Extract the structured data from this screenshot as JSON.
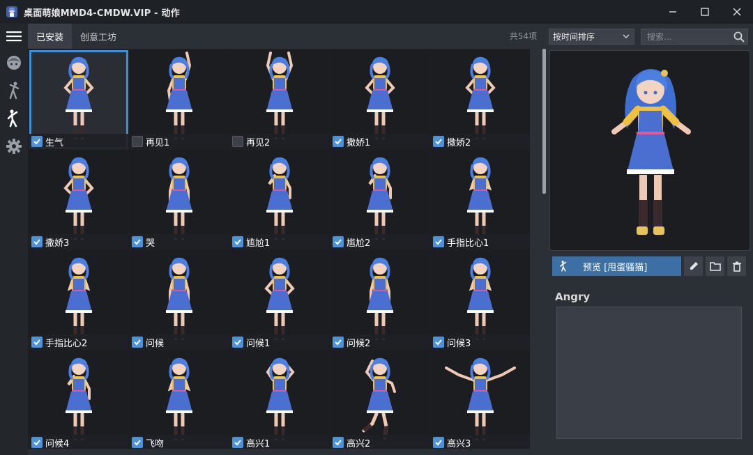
{
  "window": {
    "title": "桌面萌娘MMD4-CMDW.VIP - 动作",
    "controls": [
      "minimize-icon",
      "maximize-icon",
      "close-icon"
    ]
  },
  "rail": {
    "items": [
      {
        "icon": "menu-icon"
      },
      {
        "icon": "face-icon"
      },
      {
        "icon": "pose-icon"
      },
      {
        "icon": "action-icon",
        "active": true
      },
      {
        "icon": "gear-icon"
      }
    ]
  },
  "tabs": [
    {
      "label": "已安装",
      "active": true
    },
    {
      "label": "创意工坊",
      "active": false
    }
  ],
  "count_text": "共54项",
  "sort": {
    "value": "按时间排序"
  },
  "search": {
    "placeholder": "搜索..."
  },
  "grid": {
    "items": [
      {
        "label": "生气",
        "checked": true,
        "selected": true,
        "pose": "hips"
      },
      {
        "label": "再见1",
        "checked": false,
        "pose": "waveR"
      },
      {
        "label": "再见2",
        "checked": false,
        "pose": "bothUp"
      },
      {
        "label": "撒娇1",
        "checked": true,
        "pose": "hips"
      },
      {
        "label": "撒娇2",
        "checked": true,
        "pose": "hips"
      },
      {
        "label": "撒娇3",
        "checked": true,
        "pose": "hips"
      },
      {
        "label": "哭",
        "checked": true,
        "pose": "down"
      },
      {
        "label": "尴尬1",
        "checked": true,
        "pose": "face"
      },
      {
        "label": "尴尬2",
        "checked": true,
        "pose": "face"
      },
      {
        "label": "手指比心1",
        "checked": true,
        "pose": "chest"
      },
      {
        "label": "手指比心2",
        "checked": true,
        "pose": "chest"
      },
      {
        "label": "问候",
        "checked": true,
        "pose": "down"
      },
      {
        "label": "问候1",
        "checked": true,
        "pose": "hips"
      },
      {
        "label": "问候2",
        "checked": true,
        "pose": "down"
      },
      {
        "label": "问候3",
        "checked": true,
        "pose": "chest"
      },
      {
        "label": "问候4",
        "checked": true,
        "pose": "face"
      },
      {
        "label": "飞吻",
        "checked": true,
        "pose": "chest"
      },
      {
        "label": "高兴1",
        "checked": true,
        "pose": "head"
      },
      {
        "label": "高兴2",
        "checked": true,
        "pose": "jump"
      },
      {
        "label": "高兴3",
        "checked": true,
        "pose": "wide"
      }
    ]
  },
  "preview": {
    "button_label": "预览 [甩蛋骚猫]",
    "button_icon": "action-icon",
    "tools": [
      "edit-icon",
      "folder-icon",
      "trash-icon"
    ]
  },
  "description": {
    "title": "Angry"
  },
  "colors": {
    "accent": "#3e8fd6",
    "button": "#3c6fa3",
    "hair": "#4d7fe0",
    "dress": "#4a6fd0"
  }
}
